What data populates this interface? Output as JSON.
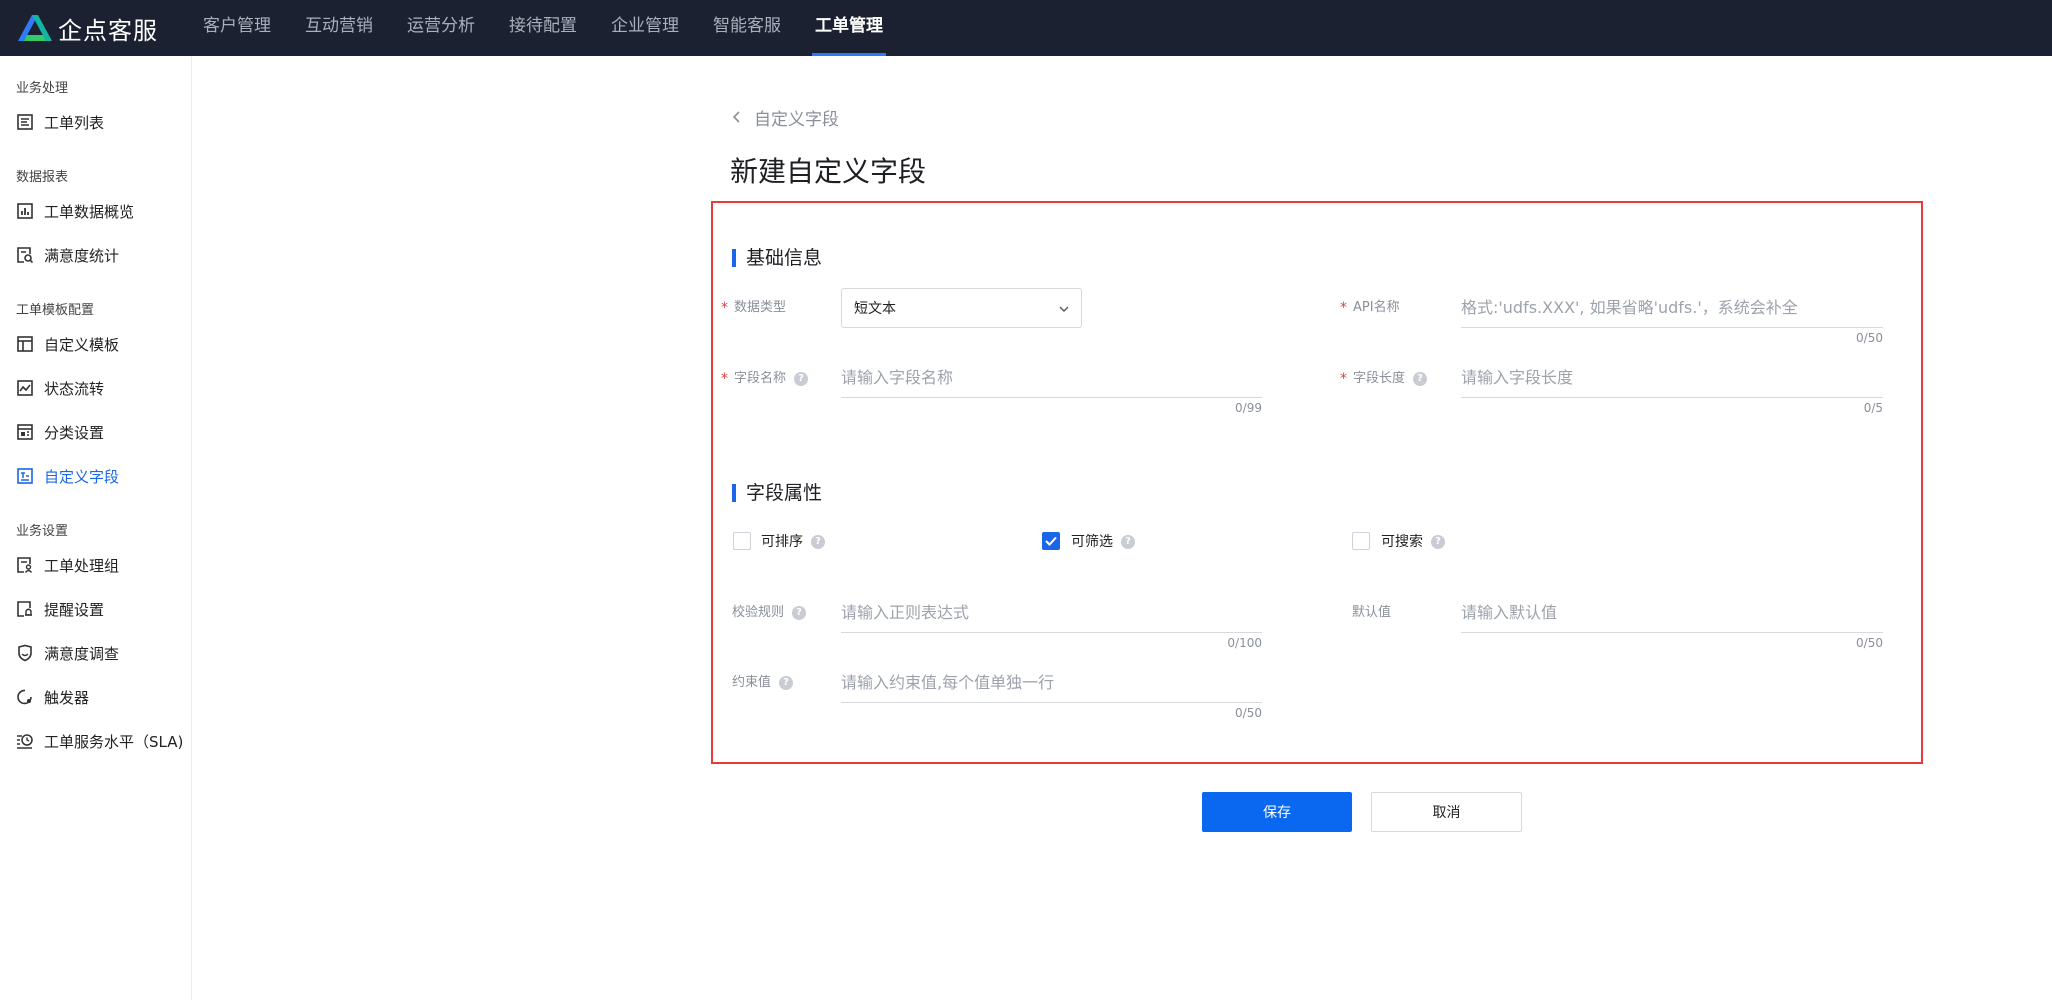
{
  "app": {
    "name": "企点客服"
  },
  "nav": {
    "items": [
      {
        "label": "客户管理"
      },
      {
        "label": "互动营销"
      },
      {
        "label": "运营分析"
      },
      {
        "label": "接待配置"
      },
      {
        "label": "企业管理"
      },
      {
        "label": "智能客服"
      },
      {
        "label": "工单管理",
        "active": true
      }
    ]
  },
  "sidebar": {
    "groups": [
      {
        "title": "业务处理",
        "items": [
          {
            "label": "工单列表",
            "icon": "list-icon"
          }
        ]
      },
      {
        "title": "数据报表",
        "items": [
          {
            "label": "工单数据概览",
            "icon": "chart-icon"
          },
          {
            "label": "满意度统计",
            "icon": "stats-icon"
          }
        ]
      },
      {
        "title": "工单模板配置",
        "items": [
          {
            "label": "自定义模板",
            "icon": "template-icon"
          },
          {
            "label": "状态流转",
            "icon": "flow-icon"
          },
          {
            "label": "分类设置",
            "icon": "category-icon"
          },
          {
            "label": "自定义字段",
            "icon": "field-icon",
            "active": true
          }
        ]
      },
      {
        "title": "业务设置",
        "items": [
          {
            "label": "工单处理组",
            "icon": "group-icon"
          },
          {
            "label": "提醒设置",
            "icon": "bell-icon"
          },
          {
            "label": "满意度调查",
            "icon": "survey-icon"
          },
          {
            "label": "触发器",
            "icon": "trigger-icon"
          },
          {
            "label": "工单服务水平（SLA)",
            "icon": "clock-icon"
          }
        ]
      }
    ]
  },
  "breadcrumb": {
    "back_label": "自定义字段"
  },
  "page": {
    "title": "新建自定义字段"
  },
  "form": {
    "basic": {
      "title": "基础信息",
      "data_type": {
        "label": "数据类型",
        "value": "短文本"
      },
      "api_name": {
        "label": "API名称",
        "placeholder": "格式:'udfs.XXX', 如果省略'udfs.'，系统会补全",
        "count": "0/50"
      },
      "field_name": {
        "label": "字段名称",
        "placeholder": "请输入字段名称",
        "count": "0/99"
      },
      "field_length": {
        "label": "字段长度",
        "placeholder": "请输入字段长度",
        "count": "0/5"
      }
    },
    "attrs": {
      "title": "字段属性",
      "sortable": {
        "label": "可排序",
        "checked": false
      },
      "filterable": {
        "label": "可筛选",
        "checked": true
      },
      "searchable": {
        "label": "可搜索",
        "checked": false
      },
      "validation": {
        "label": "校验规则",
        "placeholder": "请输入正则表达式",
        "count": "0/100"
      },
      "default_value": {
        "label": "默认值",
        "placeholder": "请输入默认值",
        "count": "0/50"
      },
      "constraint": {
        "label": "约束值",
        "placeholder": "请输入约束值,每个值单独一行",
        "count": "0/50"
      }
    }
  },
  "actions": {
    "save_label": "保存",
    "cancel_label": "取消"
  },
  "colors": {
    "accent": "#1a66e8",
    "topbar": "#1b2130",
    "highlight_frame": "#e83a3a"
  }
}
